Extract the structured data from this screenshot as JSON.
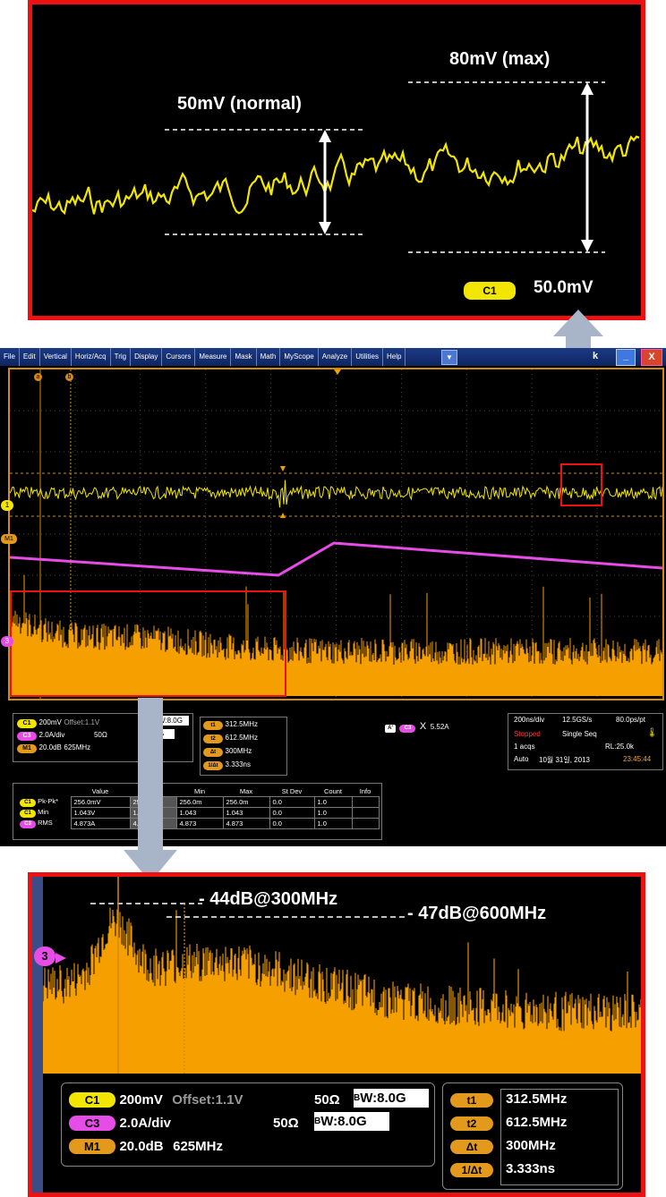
{
  "top_zoom": {
    "label_normal": "50mV (normal)",
    "label_max": "80mV (max)",
    "channel_badge": "C1",
    "scale": "50.0mV",
    "colors": {
      "trace": "#f2e600",
      "border": "#e11111"
    }
  },
  "menu": {
    "items": [
      "File",
      "Edit",
      "Vertical",
      "Horiz/Acq",
      "Trig",
      "Display",
      "Cursors",
      "Measure",
      "Mask",
      "Math",
      "MyScope",
      "Analyze",
      "Utilities",
      "Help"
    ],
    "brand_fragment": "k",
    "minimize": "_",
    "close": "X"
  },
  "waveform": {
    "cursor_a": "a",
    "cursor_b": "b",
    "ch1_marker": "1",
    "m1_marker": "M1",
    "ch3_marker": "3"
  },
  "channel_panel": {
    "c1": {
      "badge": "C1",
      "scale": "200mV",
      "offset": "Offset:1.1V",
      "bw": "8.0G",
      "impedance": "50Ω"
    },
    "c3": {
      "badge": "C3",
      "scale": "2.0A/div",
      "impedance": "50Ω",
      "bw": "8.0G"
    },
    "m1": {
      "badge": "M1",
      "scale": "20.0dB",
      "freq": "625MHz"
    },
    "bw_prefix": "B",
    "bw_sub": "W",
    "bw_value_prefix": "W:8.0G",
    "bw_partial_top": "W:8.0G",
    "bw_partial_bottom": "G"
  },
  "cursor_panel": {
    "t1": {
      "badge": "t1",
      "value": "312.5MHz"
    },
    "t2": {
      "badge": "t2",
      "value": "612.5MHz"
    },
    "dt": {
      "badge": "Δt",
      "value": "300MHz"
    },
    "inv_dt": {
      "badge": "1/Δt",
      "value": "3.333ns"
    }
  },
  "trigger": {
    "a_badge": "A'",
    "ch_badge": "C3",
    "symbol": "X",
    "level": "5.52A"
  },
  "horizontal": {
    "timebase": "200ns/div",
    "sample_rate": "12.5GS/s",
    "resolution": "80.0ps/pt",
    "state": "Stopped",
    "mode": "Single Seq",
    "acqs": "1 acqs",
    "record_length": "RL:25.0k",
    "trigger_mode": "Auto",
    "date": "10월 31일, 2013",
    "time": "23:45:44"
  },
  "measurements": {
    "headers": [
      "",
      "Value",
      "",
      "Min",
      "Max",
      "St Dev",
      "Count",
      "Info"
    ],
    "rows": [
      {
        "badge": "C1",
        "name": "Pk-Pk*",
        "value": "256.0mV",
        "mean": "25",
        "min": "256.0m",
        "max": "256.0m",
        "stdev": "0.0",
        "count": "1.0"
      },
      {
        "badge": "C1",
        "name": "Min",
        "value": "1.043V",
        "mean": "1.",
        "min": "1.043",
        "max": "1.043",
        "stdev": "0.0",
        "count": "1.0"
      },
      {
        "badge": "C3",
        "name": "RMS",
        "value": "4.873A",
        "mean": "4.",
        "min": "4.873",
        "max": "4.873",
        "stdev": "0.0",
        "count": "1.0"
      }
    ]
  },
  "bottom_zoom": {
    "label_300": "- 44dB@300MHz",
    "label_600": "- 47dB@600MHz",
    "ch_marker": "3",
    "c1_badge": "C1",
    "c1_scale": "200mV",
    "c1_offset": "Offset:1.1V",
    "c1_imp": "50Ω",
    "bw_label": "W:8.0G",
    "c3_badge": "C3",
    "c3_scale": "2.0A/div",
    "c3_imp": "50Ω",
    "m1_badge": "M1",
    "m1_scale": "20.0dB",
    "m1_freq": "625MHz",
    "t1_badge": "t1",
    "t1": "312.5MHz",
    "t2_badge": "t2",
    "t2": "612.5MHz",
    "dt_badge": "Δt",
    "dt": "300MHz",
    "inv_badge": "1/Δt",
    "inv": "3.333ns"
  }
}
